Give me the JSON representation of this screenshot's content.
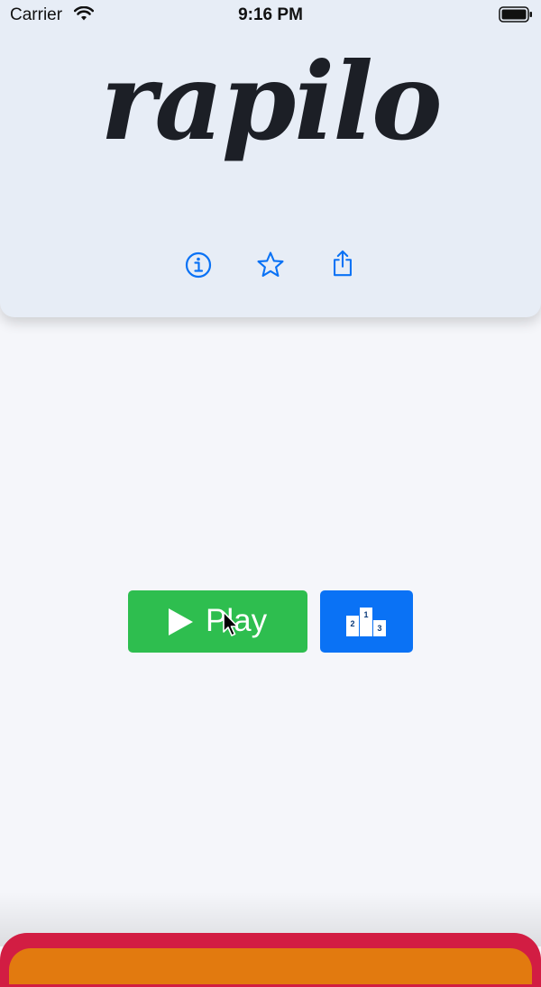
{
  "status_bar": {
    "carrier": "Carrier",
    "time": "9:16 PM"
  },
  "header": {
    "logo": "rapilo",
    "icons": [
      "info-icon",
      "star-icon",
      "share-icon"
    ]
  },
  "main": {
    "play_label": "Play",
    "leaderboard_icon": "podium-icon",
    "podium_numbers": [
      "1",
      "2",
      "3"
    ]
  },
  "colors": {
    "header_bg": "#e7edf6",
    "page_bg": "#f5f6fa",
    "accent_blue": "#0a72f5",
    "play_green": "#2ebe4f",
    "bottom_red": "#d21d43",
    "bottom_orange": "#e27a0f"
  }
}
